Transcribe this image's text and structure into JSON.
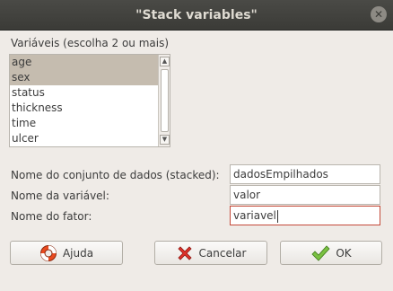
{
  "window": {
    "title": "\"Stack variables\""
  },
  "variables": {
    "label": "Variáveis (escolha 2 ou mais)",
    "items": [
      {
        "name": "age",
        "selected": true
      },
      {
        "name": "sex",
        "selected": true
      },
      {
        "name": "status",
        "selected": false
      },
      {
        "name": "thickness",
        "selected": false
      },
      {
        "name": "time",
        "selected": false
      },
      {
        "name": "ulcer",
        "selected": false
      }
    ]
  },
  "form": {
    "dataset_label": "Nome do conjunto de dados (stacked):",
    "dataset_value": "dadosEmpilhados",
    "variable_label": "Nome da variável:",
    "variable_value": "valor",
    "factor_label": "Nome do fator:",
    "factor_value": "variavel"
  },
  "buttons": {
    "help": "Ajuda",
    "cancel": "Cancelar",
    "ok": "OK"
  },
  "icons": {
    "close": "close-icon",
    "help": "lifebuoy-icon",
    "cancel": "red-x-icon",
    "ok": "green-check-icon"
  },
  "colors": {
    "selection": "#c5bcaf",
    "focus_border": "#c44a3a"
  }
}
